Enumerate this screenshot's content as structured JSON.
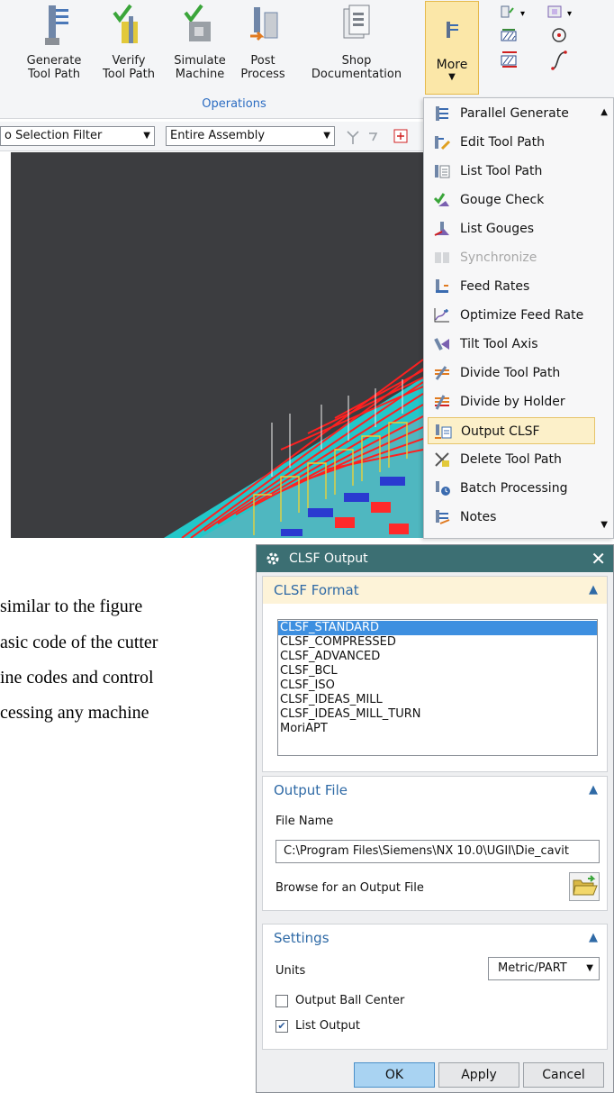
{
  "ribbon": {
    "buttons": [
      {
        "line1": "Generate",
        "line2": "Tool Path"
      },
      {
        "line1": "Verify",
        "line2": "Tool Path"
      },
      {
        "line1": "Simulate",
        "line2": "Machine"
      },
      {
        "line1": "Post",
        "line2": "Process"
      },
      {
        "line1": "Shop",
        "line2": "Documentation"
      }
    ],
    "group_label": "Operations",
    "more_label": "More"
  },
  "toolbar": {
    "selection_filter": "o Selection Filter",
    "assembly_scope": "Entire Assembly"
  },
  "menu": {
    "items": [
      {
        "label": "Parallel Generate",
        "icon": "parallel-generate-icon",
        "disabled": false
      },
      {
        "label": "Edit Tool Path",
        "icon": "edit-tool-path-icon",
        "disabled": false
      },
      {
        "label": "List Tool Path",
        "icon": "list-tool-path-icon",
        "disabled": false
      },
      {
        "label": "Gouge Check",
        "icon": "gouge-check-icon",
        "disabled": false
      },
      {
        "label": "List Gouges",
        "icon": "list-gouges-icon",
        "disabled": false
      },
      {
        "label": "Synchronize",
        "icon": "synchronize-icon",
        "disabled": true
      },
      {
        "label": "Feed Rates",
        "icon": "feed-rates-icon",
        "disabled": false
      },
      {
        "label": "Optimize Feed Rate",
        "icon": "optimize-feed-rate-icon",
        "disabled": false
      },
      {
        "label": "Tilt Tool Axis",
        "icon": "tilt-tool-axis-icon",
        "disabled": false
      },
      {
        "label": "Divide Tool Path",
        "icon": "divide-tool-path-icon",
        "disabled": false
      },
      {
        "label": "Divide by Holder",
        "icon": "divide-by-holder-icon",
        "disabled": false
      },
      {
        "label": "Output CLSF",
        "icon": "output-clsf-icon",
        "disabled": false,
        "selected": true
      },
      {
        "label": "Delete Tool Path",
        "icon": "delete-tool-path-icon",
        "disabled": false
      },
      {
        "label": "Batch Processing",
        "icon": "batch-processing-icon",
        "disabled": false
      },
      {
        "label": "Notes",
        "icon": "notes-icon",
        "disabled": false
      }
    ]
  },
  "doc_text": {
    "line1": "similar to the figure",
    "line2": "asic code of the cutter",
    "line3": "ine codes and control",
    "line4": "cessing any machine"
  },
  "dialog": {
    "title": "CLSF Output",
    "clsf_format": {
      "header": "CLSF Format",
      "options": [
        "CLSF_STANDARD",
        "CLSF_COMPRESSED",
        "CLSF_ADVANCED",
        "CLSF_BCL",
        "CLSF_ISO",
        "CLSF_IDEAS_MILL",
        "CLSF_IDEAS_MILL_TURN",
        "MoriAPT"
      ],
      "selected": "CLSF_STANDARD"
    },
    "output_file": {
      "header": "Output File",
      "file_name_label": "File Name",
      "file_name_value": "C:\\Program Files\\Siemens\\NX 10.0\\UGII\\Die_cavit",
      "browse_label": "Browse for an Output File"
    },
    "settings": {
      "header": "Settings",
      "units_label": "Units",
      "units_value": "Metric/PART",
      "output_ball_center_label": "Output Ball Center",
      "output_ball_center_checked": false,
      "list_output_label": "List Output",
      "list_output_checked": true
    },
    "buttons": {
      "ok": "OK",
      "apply": "Apply",
      "cancel": "Cancel"
    }
  }
}
